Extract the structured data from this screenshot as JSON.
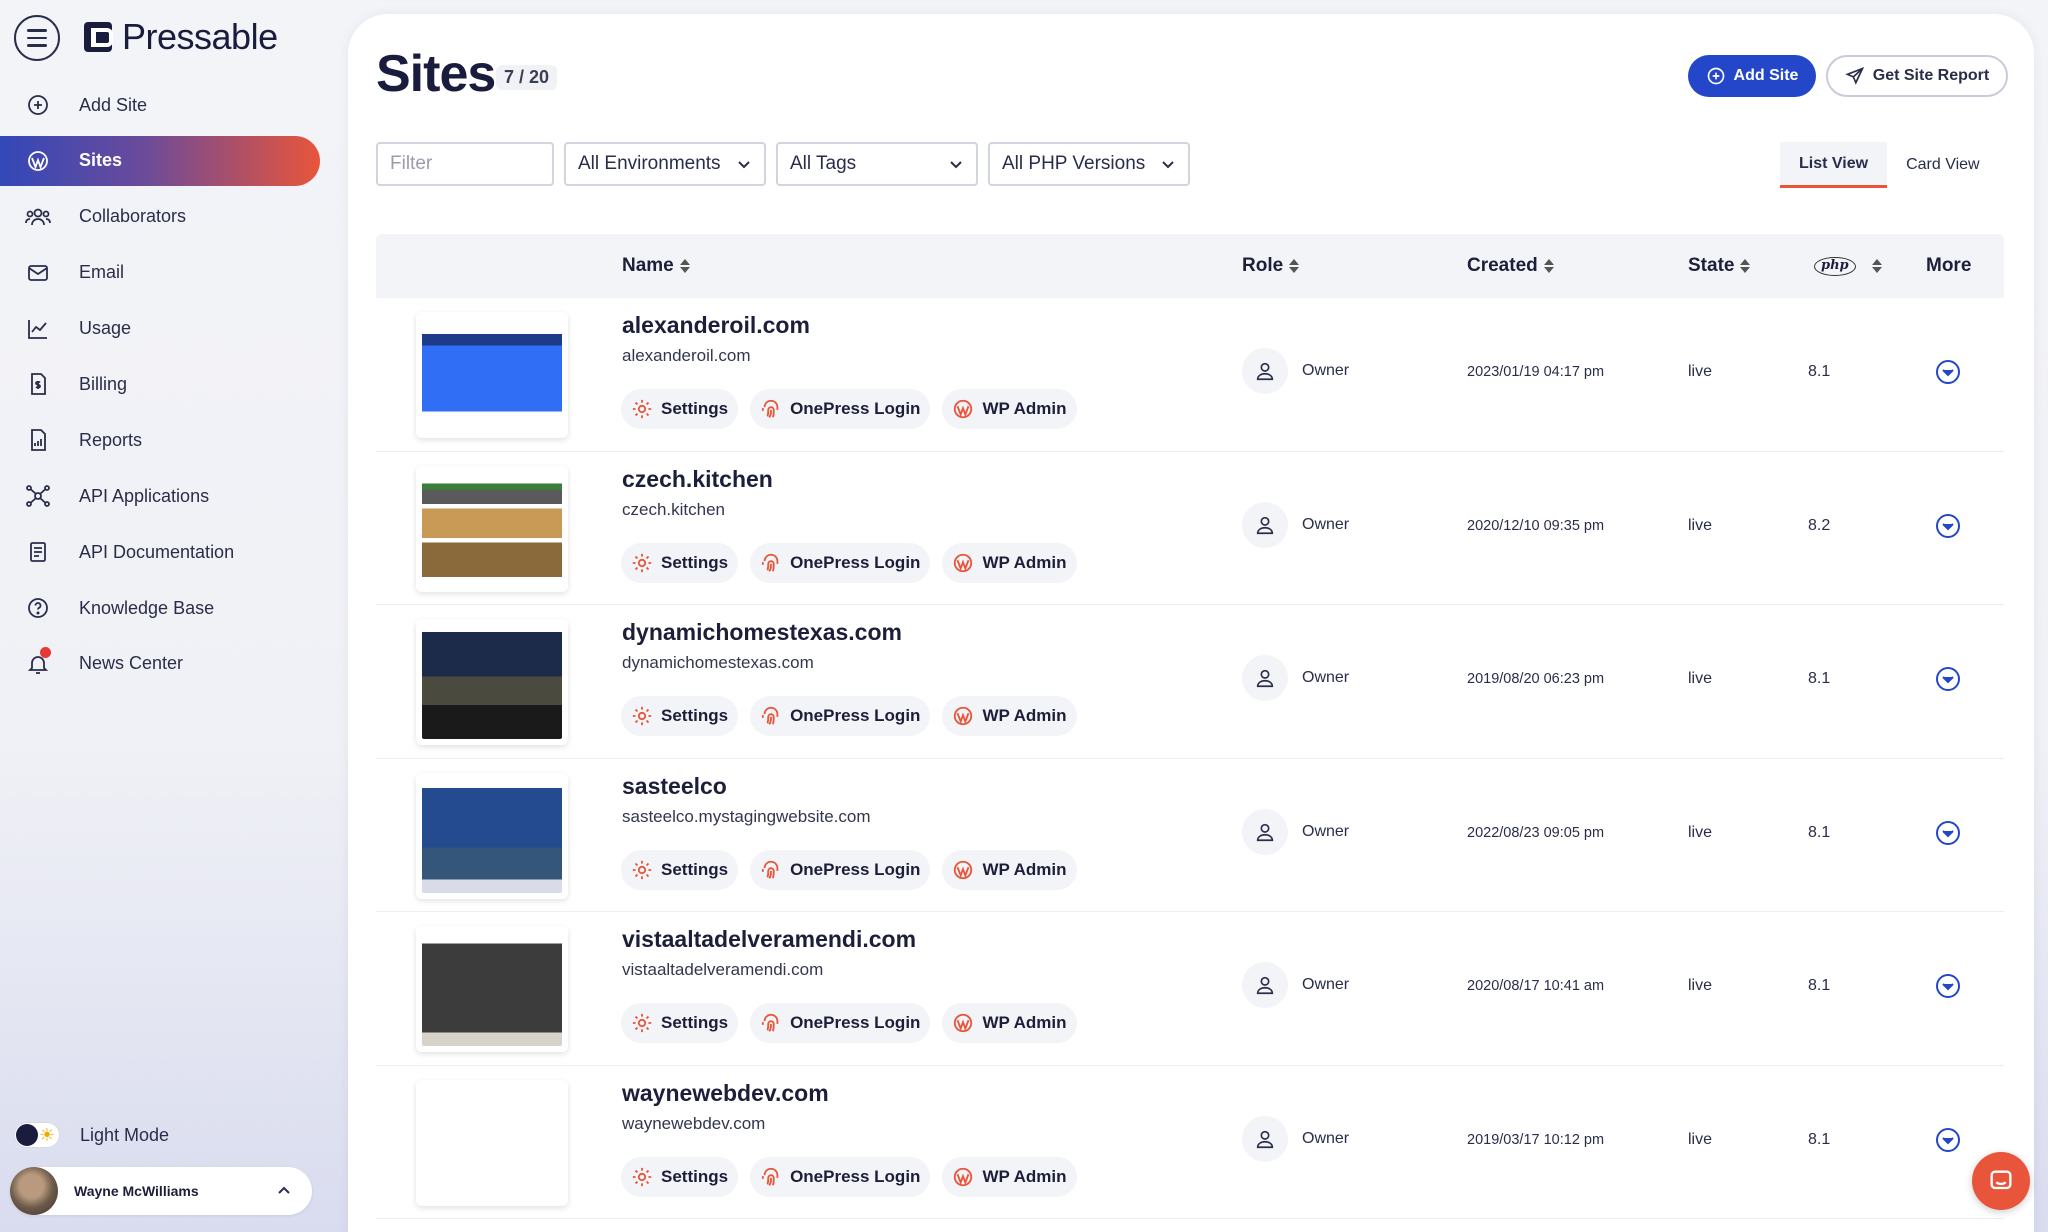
{
  "app": {
    "name": "Pressable"
  },
  "sidebar": {
    "items": [
      {
        "label": "Add Site",
        "icon": "plus-circle-icon"
      },
      {
        "label": "Sites",
        "icon": "wordpress-icon",
        "active": true
      },
      {
        "label": "Collaborators",
        "icon": "users-icon"
      },
      {
        "label": "Email",
        "icon": "envelope-icon"
      },
      {
        "label": "Usage",
        "icon": "line-chart-icon"
      },
      {
        "label": "Billing",
        "icon": "billing-doc-icon"
      },
      {
        "label": "Reports",
        "icon": "report-doc-icon"
      },
      {
        "label": "API Applications",
        "icon": "network-icon"
      },
      {
        "label": "API Documentation",
        "icon": "document-icon"
      },
      {
        "label": "Knowledge Base",
        "icon": "question-circle-icon"
      },
      {
        "label": "News Center",
        "icon": "bell-icon",
        "notification": true
      }
    ],
    "mode_label": "Light Mode",
    "user_name": "Wayne McWilliams"
  },
  "header": {
    "title": "Sites",
    "count": "7 / 20",
    "add_site": "Add Site",
    "get_report": "Get Site Report"
  },
  "filters": {
    "placeholder": "Filter",
    "environments": "All Environments",
    "tags": "All Tags",
    "php": "All PHP Versions"
  },
  "tabs": {
    "list": "List View",
    "card": "Card View"
  },
  "table": {
    "columns": {
      "name": "Name",
      "role": "Role",
      "created": "Created",
      "state": "State",
      "php": "php",
      "more": "More"
    },
    "action_labels": {
      "settings": "Settings",
      "onepress": "OnePress Login",
      "wpadmin": "WP Admin"
    },
    "rows": [
      {
        "name": "alexanderoil.com",
        "domain": "alexanderoil.com",
        "role": "Owner",
        "created": "2023/01/19 04:17 pm",
        "state": "live",
        "php": "8.1"
      },
      {
        "name": "czech.kitchen",
        "domain": "czech.kitchen",
        "role": "Owner",
        "created": "2020/12/10 09:35 pm",
        "state": "live",
        "php": "8.2"
      },
      {
        "name": "dynamichomestexas.com",
        "domain": "dynamichomestexas.com",
        "role": "Owner",
        "created": "2019/08/20 06:23 pm",
        "state": "live",
        "php": "8.1"
      },
      {
        "name": "sasteelco",
        "domain": "sasteelco.mystagingwebsite.com",
        "role": "Owner",
        "created": "2022/08/23 09:05 pm",
        "state": "live",
        "php": "8.1"
      },
      {
        "name": "vistaaltadelveramendi.com",
        "domain": "vistaaltadelveramendi.com",
        "role": "Owner",
        "created": "2020/08/17 10:41 am",
        "state": "live",
        "php": "8.1"
      },
      {
        "name": "waynewebdev.com",
        "domain": "waynewebdev.com",
        "role": "Owner",
        "created": "2019/03/17 10:12 pm",
        "state": "live",
        "php": "8.1"
      }
    ]
  },
  "colors": {
    "accent": "#e8553a",
    "primary": "#2347c8",
    "dark": "#1a1c3d"
  }
}
